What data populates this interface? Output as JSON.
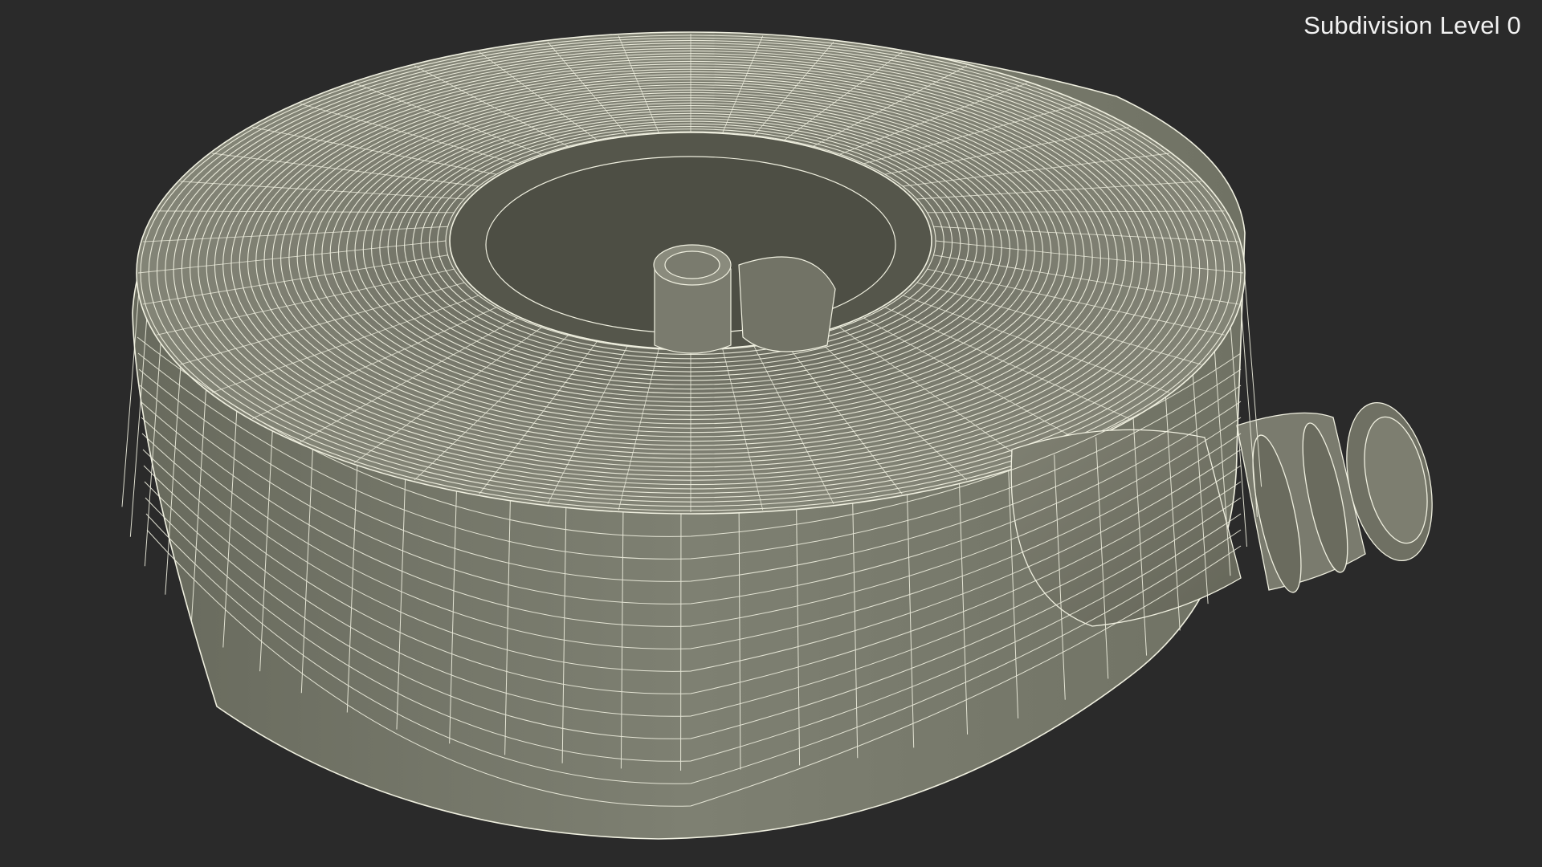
{
  "viewport": {
    "overlay_label": "Subdivision Level 0",
    "background_color": "#2a2a2a",
    "mesh_fill_color": "#7e7f70",
    "mesh_fill_dark": "#5f6055",
    "mesh_fill_light": "#8c8d7e",
    "wire_color": "#f0f0e0"
  }
}
